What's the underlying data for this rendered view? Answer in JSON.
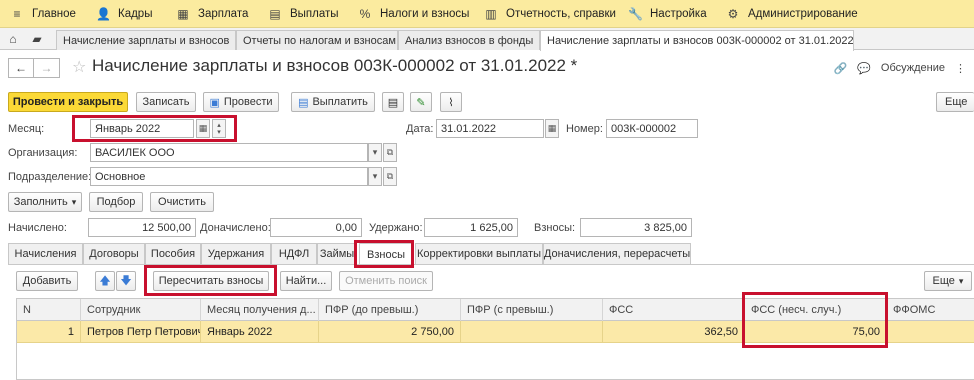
{
  "topbar": [
    {
      "icon": "≡",
      "icon_name": "menu-icon",
      "label": "Главное"
    },
    {
      "icon": "👤",
      "icon_name": "personnel-icon",
      "label": "Кадры"
    },
    {
      "icon": "▦",
      "icon_name": "salary-icon",
      "label": "Зарплата"
    },
    {
      "icon": "▤",
      "icon_name": "payments-icon",
      "label": "Выплаты"
    },
    {
      "icon": "%",
      "icon_name": "percent-icon",
      "label": "Налоги и взносы"
    },
    {
      "icon": "▥",
      "icon_name": "reports-icon",
      "label": "Отчетность, справки"
    },
    {
      "icon": "🔧",
      "icon_name": "wrench-icon",
      "label": "Настройка"
    },
    {
      "icon": "⚙",
      "icon_name": "gear-icon",
      "label": "Администрирование"
    }
  ],
  "doc_tabs": [
    {
      "label": "Начисление зарплаты и взносов",
      "active": false
    },
    {
      "label": "Отчеты по налогам и взносам",
      "active": false
    },
    {
      "label": "Анализ взносов в фонды",
      "active": false
    },
    {
      "label": "Начисление зарплаты и взносов 003К-000002 от 31.01.2022 *",
      "active": true
    }
  ],
  "header": {
    "title": "Начисление зарплаты и взносов 003К-000002 от 31.01.2022 *",
    "discussion": "Обсуждение",
    "more": "Еще"
  },
  "toolbar": {
    "post_close": "Провести и закрыть",
    "write": "Записать",
    "post": "Провести",
    "pay": "Выплатить"
  },
  "form": {
    "month_label": "Месяц:",
    "month_value": "Январь 2022",
    "date_label": "Дата:",
    "date_value": "31.01.2022",
    "number_label": "Номер:",
    "number_value": "003К-000002",
    "org_label": "Организация:",
    "org_value": "ВАСИЛЕК ООО",
    "dept_label": "Подразделение:",
    "dept_value": "Основное",
    "fill_btn": "Заполнить",
    "pick_btn": "Подбор",
    "clear_btn": "Очистить"
  },
  "totals": {
    "accrued_label": "Начислено:",
    "accrued_value": "12 500,00",
    "extra_label": "Доначислено:",
    "extra_value": "0,00",
    "withheld_label": "Удержано:",
    "withheld_value": "1 625,00",
    "contrib_label": "Взносы:",
    "contrib_value": "3 825,00"
  },
  "form_tabs": [
    {
      "label": "Начисления",
      "active": false
    },
    {
      "label": "Договоры",
      "active": false
    },
    {
      "label": "Пособия",
      "active": false
    },
    {
      "label": "Удержания",
      "active": false
    },
    {
      "label": "НДФЛ",
      "active": false
    },
    {
      "label": "Займы",
      "active": false
    },
    {
      "label": "Взносы",
      "active": true
    },
    {
      "label": "Корректировки выплаты",
      "active": false
    },
    {
      "label": "Доначисления, перерасчеты",
      "active": false
    }
  ],
  "grid_toolbar": {
    "add": "Добавить",
    "recalc": "Пересчитать взносы",
    "find": "Найти...",
    "cancel_search": "Отменить поиск",
    "more": "Еще"
  },
  "grid": {
    "columns": [
      "N",
      "Сотрудник",
      "Месяц получения д...",
      "ПФР (до превыш.)",
      "ПФР (с превыш.)",
      "ФСС",
      "ФСС (несч. случ.)",
      "ФФОМС"
    ],
    "rows": [
      [
        "1",
        "Петров Петр Петрович",
        "Январь 2022",
        "2 750,00",
        "",
        "362,50",
        "75,00",
        ""
      ]
    ]
  }
}
